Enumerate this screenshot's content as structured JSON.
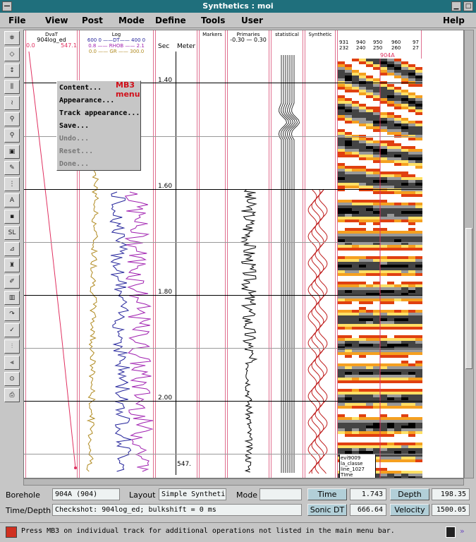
{
  "window": {
    "title": "Synthetics : moi"
  },
  "menubar": [
    "File",
    "View",
    "Post",
    "Mode",
    "Define",
    "Tools",
    "User",
    "Help"
  ],
  "tracks": {
    "dvat": {
      "title": "DvaT",
      "sub": "904log_ed",
      "min": "0.0",
      "max": "547.1"
    },
    "log": {
      "title": "Log",
      "row1": "600 0 ——DT—— 400 0",
      "row2": "0.8 —— RHOB —— 2.1",
      "row3": "0.0 —— GR —— 300.0"
    },
    "time": {
      "sec": "Sec",
      "meter": "Meter",
      "ticks": [
        "1.40",
        "1.60",
        "1.80",
        "2.00"
      ],
      "bottom": "547."
    },
    "markers": {
      "title": "Markers"
    },
    "primaries": {
      "title": "Primaries",
      "scale": "-0.30 — 0.30"
    },
    "statistical": {
      "title": "statistical"
    },
    "synthetic": {
      "title": "Synthetic"
    },
    "seismic": {
      "top_nums": [
        "931",
        "940",
        "950",
        "960",
        "97"
      ],
      "bot_nums": [
        "232",
        "240",
        "250",
        "260",
        "27"
      ],
      "well_label": "904A",
      "info": [
        "evi9009",
        "la_classe",
        "line_1027",
        "TIme"
      ]
    }
  },
  "popup_menu": {
    "tag": "MB3 menu",
    "items": [
      {
        "label": "Content...",
        "enabled": true
      },
      {
        "label": "Appearance...",
        "enabled": true
      },
      {
        "label": "Track appearance...",
        "enabled": true
      },
      {
        "label": "Save...",
        "enabled": true
      },
      {
        "label": "Undo...",
        "enabled": false
      },
      {
        "label": "Reset...",
        "enabled": false
      },
      {
        "label": "Done...",
        "enabled": false
      }
    ]
  },
  "form": {
    "borehole_label": "Borehole",
    "borehole_value": "904A (904)",
    "layout_label": "Layout",
    "layout_value": "Simple Syntheti",
    "mode_label": "Mode",
    "mode_value": "",
    "timedepth_label": "Time/Depth",
    "timedepth_value": "Checkshot: 904log_ed; bulkshift = 0 ms",
    "time_btn": "Time",
    "time_value": "1.743",
    "depth_btn": "Depth",
    "depth_value": "198.35",
    "sonic_btn": "Sonic DT",
    "sonic_value": "666.64",
    "velocity_btn": "Velocity",
    "velocity_value": "1500.05"
  },
  "status": {
    "message": "Press MB3 on individual track for additional operations not listed in the main menu bar."
  },
  "colors": {
    "title_bar": "#1f6f7c",
    "track_border": "#e07090",
    "button": "#b2cfd8"
  }
}
